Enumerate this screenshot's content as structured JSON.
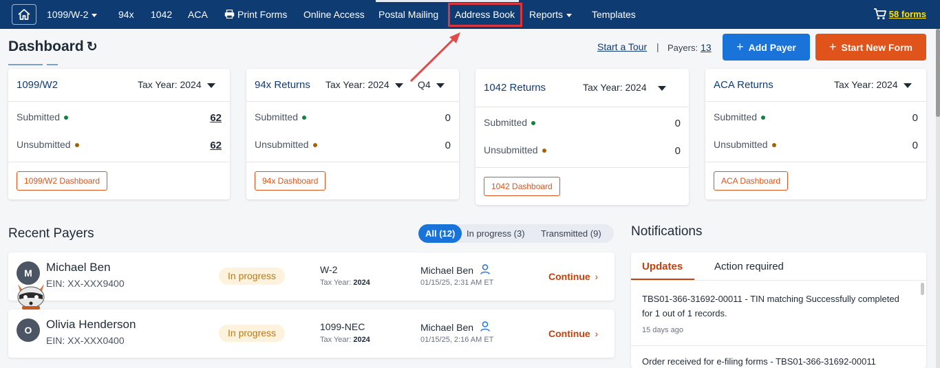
{
  "nav": {
    "items": [
      "1099/W-2",
      "94x",
      "1042",
      "ACA",
      "Print Forms",
      "Online Access",
      "Postal Mailing",
      "Address Book",
      "Reports",
      "Templates"
    ],
    "cart": "58 forms"
  },
  "header": {
    "title": "Dashboard",
    "tour": "Start a Tour",
    "sep": "|",
    "payers_label": "Payers:",
    "payers_count": "13",
    "add_payer": "Add Payer",
    "start_form": "Start New Form"
  },
  "cards": [
    {
      "title": "1099/W2",
      "year": "Tax Year: 2024",
      "submitted_label": "Submitted",
      "submitted": "62",
      "unsubmitted_label": "Unsubmitted",
      "unsubmitted": "62",
      "button": "1099/W2 Dashboard"
    },
    {
      "title": "94x Returns",
      "year": "Tax Year: 2024",
      "quarter": "Q4",
      "submitted_label": "Submitted",
      "submitted": "0",
      "unsubmitted_label": "Unsubmitted",
      "unsubmitted": "0",
      "button": "94x Dashboard"
    },
    {
      "title": "1042 Returns",
      "year": "Tax Year: 2024",
      "submitted_label": "Submitted",
      "submitted": "0",
      "unsubmitted_label": "Unsubmitted",
      "unsubmitted": "0",
      "button": "1042 Dashboard"
    },
    {
      "title": "ACA Returns",
      "year": "Tax Year: 2024",
      "submitted_label": "Submitted",
      "submitted": "0",
      "unsubmitted_label": "Unsubmitted",
      "unsubmitted": "0",
      "button": "ACA Dashboard"
    }
  ],
  "recent": {
    "title": "Recent Payers",
    "filters": [
      "All (12)",
      "In progress (3)",
      "Transmitted (9)"
    ],
    "rows": [
      {
        "initial": "M",
        "name": "Michael Ben",
        "ein": "EIN: XX-XXX9400",
        "status": "In progress",
        "form": "W-2",
        "tax_year_label": "Tax Year:",
        "tax_year": "2024",
        "by": "Michael Ben",
        "date": "01/15/25, 2:31 AM ET",
        "action": "Continue"
      },
      {
        "initial": "O",
        "name": "Olivia Henderson",
        "ein": "EIN: XX-XXX0400",
        "status": "In progress",
        "form": "1099-NEC",
        "tax_year_label": "Tax Year:",
        "tax_year": "2024",
        "by": "Michael Ben",
        "date": "01/15/25, 2:16 AM ET",
        "action": "Continue"
      }
    ]
  },
  "notifications": {
    "title": "Notifications",
    "tabs": [
      "Updates",
      "Action required"
    ],
    "items": [
      {
        "text": "TBS01-366-31692-00011 - TIN matching Successfully completed for 1 out of 1 records.",
        "time": "15 days ago"
      },
      {
        "text": "Order received for e-filing forms - TBS01-366-31692-00011",
        "time": ""
      }
    ]
  },
  "colors": {
    "nav": "#0f3b73",
    "primary": "#1a73d9",
    "accent": "#e0531a",
    "green_dot": "#15803d",
    "amber_dot": "#a16207",
    "highlight": "#d9363e"
  }
}
